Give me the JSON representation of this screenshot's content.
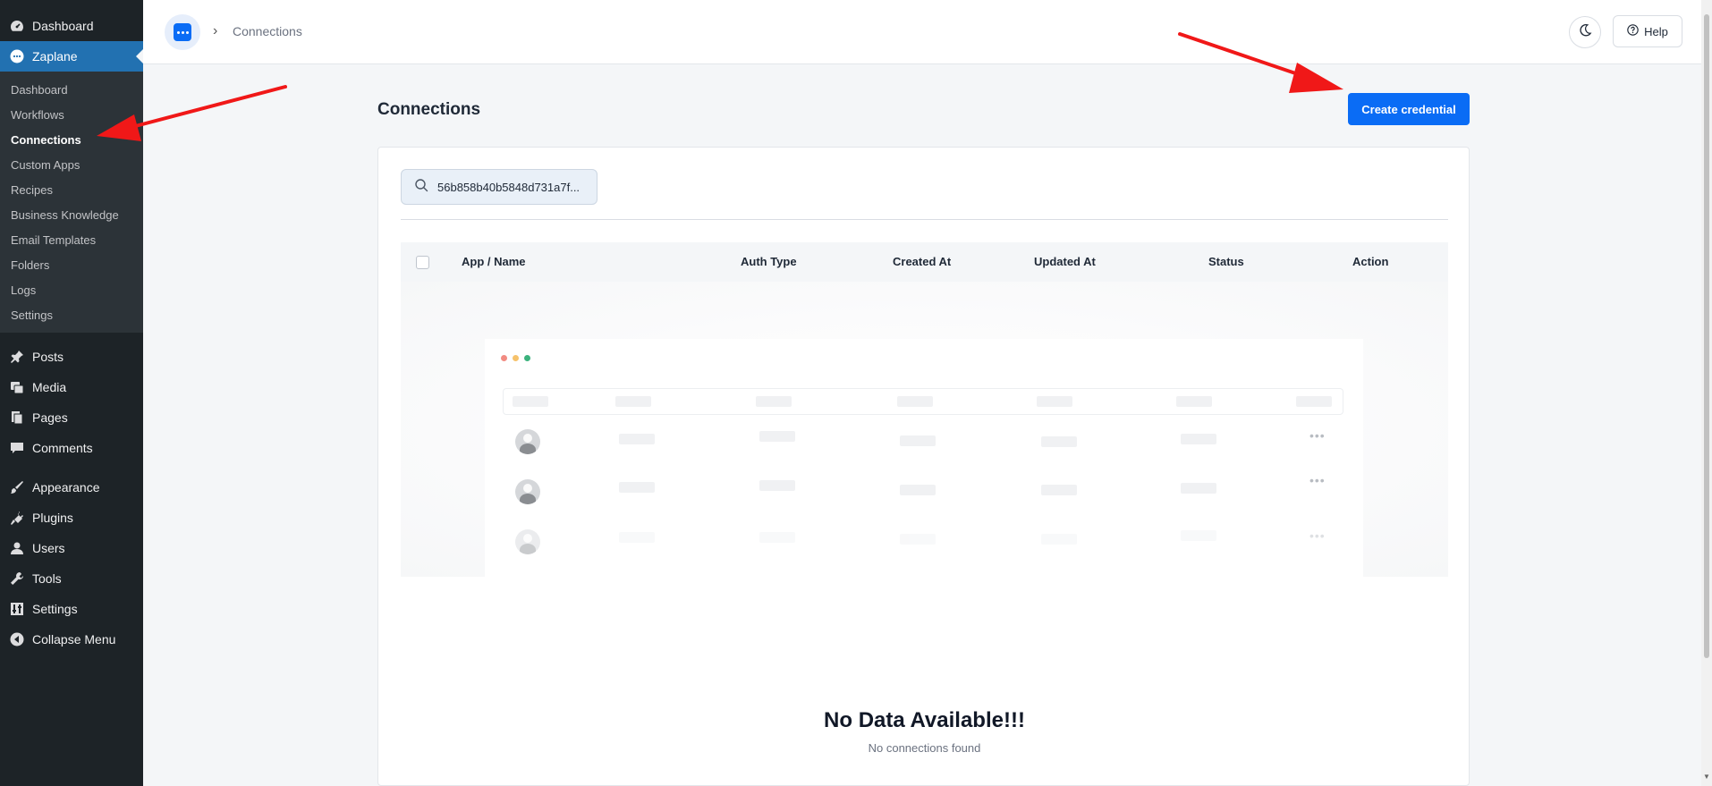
{
  "wp_menu": {
    "top": [
      {
        "label": "Dashboard",
        "icon": "gauge-icon"
      },
      {
        "label": "Zaplane",
        "icon": "zaplane-icon"
      }
    ],
    "zaplane_submenu": [
      "Dashboard",
      "Workflows",
      "Connections",
      "Custom Apps",
      "Recipes",
      "Business Knowledge",
      "Email Templates",
      "Folders",
      "Logs",
      "Settings"
    ],
    "group2": [
      {
        "label": "Posts",
        "icon": "pin-icon"
      },
      {
        "label": "Media",
        "icon": "media-icon"
      },
      {
        "label": "Pages",
        "icon": "pages-icon"
      },
      {
        "label": "Comments",
        "icon": "comment-icon"
      }
    ],
    "group3": [
      {
        "label": "Appearance",
        "icon": "brush-icon"
      },
      {
        "label": "Plugins",
        "icon": "plug-icon"
      },
      {
        "label": "Users",
        "icon": "user-icon"
      },
      {
        "label": "Tools",
        "icon": "wrench-icon"
      },
      {
        "label": "Settings",
        "icon": "sliders-icon"
      },
      {
        "label": "Collapse Menu",
        "icon": "collapse-icon"
      }
    ]
  },
  "header": {
    "breadcrumb": "Connections",
    "help_label": "Help"
  },
  "main": {
    "title": "Connections",
    "create_button": "Create credential",
    "search_value": "56b858b40b5848d731a7f...",
    "table_headers": [
      "App / Name",
      "Auth Type",
      "Created At",
      "Updated At",
      "Status",
      "Action"
    ],
    "empty_title": "No Data Available!!!",
    "empty_subtitle": "No connections found"
  },
  "colors": {
    "primary": "#0a6cf5",
    "wp_active": "#2271b1",
    "wp_sidebar": "#1d2327",
    "annotation_arrow": "#f01818"
  }
}
